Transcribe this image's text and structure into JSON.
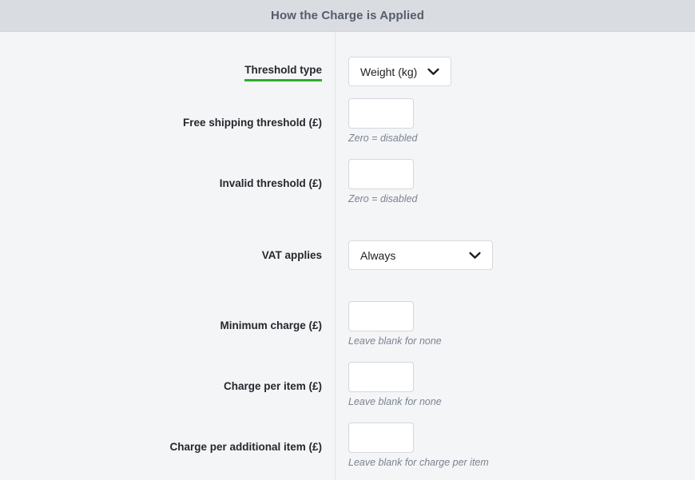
{
  "header": {
    "title": "How the Charge is Applied"
  },
  "form": {
    "sections": [
      {
        "name": "threshold",
        "rows": [
          {
            "name": "threshold-type",
            "label": "Threshold type",
            "label_underlined": true,
            "control": "select",
            "value": "Weight (kg)",
            "hint": ""
          },
          {
            "name": "free-shipping-threshold",
            "label": "Free shipping threshold (£)",
            "label_underlined": false,
            "control": "input",
            "value": "",
            "placeholder": "",
            "hint": "Zero = disabled"
          },
          {
            "name": "invalid-threshold",
            "label": "Invalid threshold (£)",
            "label_underlined": false,
            "control": "input",
            "value": "",
            "placeholder": "",
            "hint": "Zero = disabled"
          }
        ]
      },
      {
        "name": "vat",
        "rows": [
          {
            "name": "vat-applies",
            "label": "VAT applies",
            "label_underlined": false,
            "control": "select",
            "value": "Always",
            "hint": ""
          }
        ]
      },
      {
        "name": "charges",
        "rows": [
          {
            "name": "minimum-charge",
            "label": "Minimum charge (£)",
            "label_underlined": false,
            "control": "input",
            "value": "",
            "placeholder": "",
            "hint": "Leave blank for none"
          },
          {
            "name": "charge-per-item",
            "label": "Charge per item (£)",
            "label_underlined": false,
            "control": "input",
            "value": "",
            "placeholder": "",
            "hint": "Leave blank for none"
          },
          {
            "name": "charge-per-additional-item",
            "label": "Charge per additional item (£)",
            "label_underlined": false,
            "control": "input",
            "value": "",
            "placeholder": "",
            "hint": "Leave blank for charge per item"
          }
        ]
      }
    ]
  },
  "icons": {
    "chevron_down": "chevron-down-icon"
  },
  "colors": {
    "header_bg": "#d9dce1",
    "header_text": "#555d6b",
    "page_bg": "#f4f5f7",
    "label_text": "#25282d",
    "hint_text": "#7b8391",
    "accent_underline": "#2eab2e",
    "input_border": "#d4d8de",
    "divider": "#e2e4e8"
  }
}
